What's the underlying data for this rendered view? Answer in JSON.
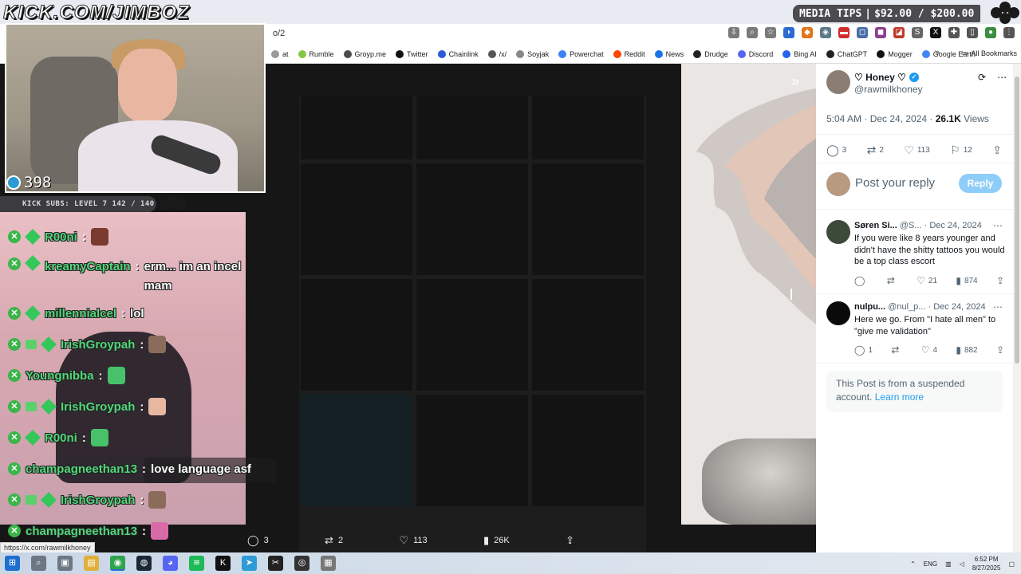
{
  "overlay": {
    "title": "KICK.COM/JIMBOZ",
    "tips_label": "MEDIA TIPS",
    "tips_separator": "|",
    "tips_value": "$92.00 / $200.00",
    "viewer_count": "398",
    "subs_label": "KICK SUBS: LEVEL 7 142 / 140"
  },
  "chat": {
    "messages": [
      {
        "user": "R00ni",
        "text": "",
        "emote_color": "#7a3b2e"
      },
      {
        "user": "kreamyCaptain",
        "text": "erm... im an incel mam",
        "emote_color": ""
      },
      {
        "user": "millennialcel",
        "text": "lol",
        "emote_color": ""
      },
      {
        "user": "IrishGroypah",
        "text": "",
        "emote_color": "#8b6b5a"
      },
      {
        "user": "Youngnibba",
        "text": "",
        "emote_color": "#47c26a"
      },
      {
        "user": "IrishGroypah",
        "text": "",
        "emote_color": "#e7b7a0"
      },
      {
        "user": "R00ni",
        "text": "",
        "emote_color": "#47c26a"
      },
      {
        "user": "champagneethan13",
        "text": "love language asf",
        "emote_color": ""
      },
      {
        "user": "IrishGroypah",
        "text": "",
        "emote_color": "#8b6b5a"
      },
      {
        "user": "champagneethan13",
        "text": "",
        "emote_color": "#d96aa8"
      }
    ],
    "colon": ":"
  },
  "browser": {
    "url_fragment": "o/2",
    "status_url": "https://x.com/rawmilkhoney",
    "bookmarks": [
      {
        "label": "at",
        "color": "#999999"
      },
      {
        "label": "Rumble",
        "color": "#85c742"
      },
      {
        "label": "Groyp.me",
        "color": "#4a4a4a"
      },
      {
        "label": "Twitter",
        "color": "#111111"
      },
      {
        "label": "Chainlink",
        "color": "#2a5ada"
      },
      {
        "label": "/x/",
        "color": "#555555"
      },
      {
        "label": "Soyjak",
        "color": "#888888"
      },
      {
        "label": "Powerchat",
        "color": "#3b82f6"
      },
      {
        "label": "Reddit",
        "color": "#ff4500"
      },
      {
        "label": "News",
        "color": "#1a73e8"
      },
      {
        "label": "Drudge",
        "color": "#222222"
      },
      {
        "label": "Discord",
        "color": "#5865f2"
      },
      {
        "label": "Bing AI",
        "color": "#2563eb"
      },
      {
        "label": "ChatGPT",
        "color": "#222222"
      },
      {
        "label": "Mogger",
        "color": "#111111"
      },
      {
        "label": "Google Earth",
        "color": "#4285f4"
      }
    ],
    "bookmarks_more": "»",
    "all_bookmarks": "All Bookmarks"
  },
  "viewer": {
    "comments": "3",
    "reposts": "2",
    "likes": "113",
    "views": "26K"
  },
  "post": {
    "name": "♡ Honey ♡",
    "verified_mark": "✓",
    "handle": "@rawmilkhoney",
    "time": "5:04 AM · Dec 24, 2024 · ",
    "views_count": "26.1K",
    "views_label": " Views",
    "comments": "3",
    "reposts": "2",
    "likes": "113",
    "bookmarks": "12",
    "reply_placeholder": "Post your reply",
    "reply_button": "Reply"
  },
  "replies": [
    {
      "name": "Søren Si...",
      "handle": "@S...",
      "date": "· Dec 24, 2024",
      "text": "If you were like 8 years younger and didn't have the shitty tattoos you would be a top class escort",
      "replies": "",
      "reposts": "",
      "likes": "21",
      "views": "874"
    },
    {
      "name": "nulpu...",
      "handle": "@nul_p...",
      "date": "· Dec 24, 2024",
      "text": "Here we go. From \"I hate all men\" to \"give me validation\"",
      "replies": "1",
      "reposts": "",
      "likes": "4",
      "views": "882"
    }
  ],
  "suspended": {
    "text": "This Post is from a suspended account.",
    "link": "Learn more"
  },
  "taskbar": {
    "lang": "ENG",
    "time": "6:52 PM",
    "date": "8/27/2025"
  }
}
